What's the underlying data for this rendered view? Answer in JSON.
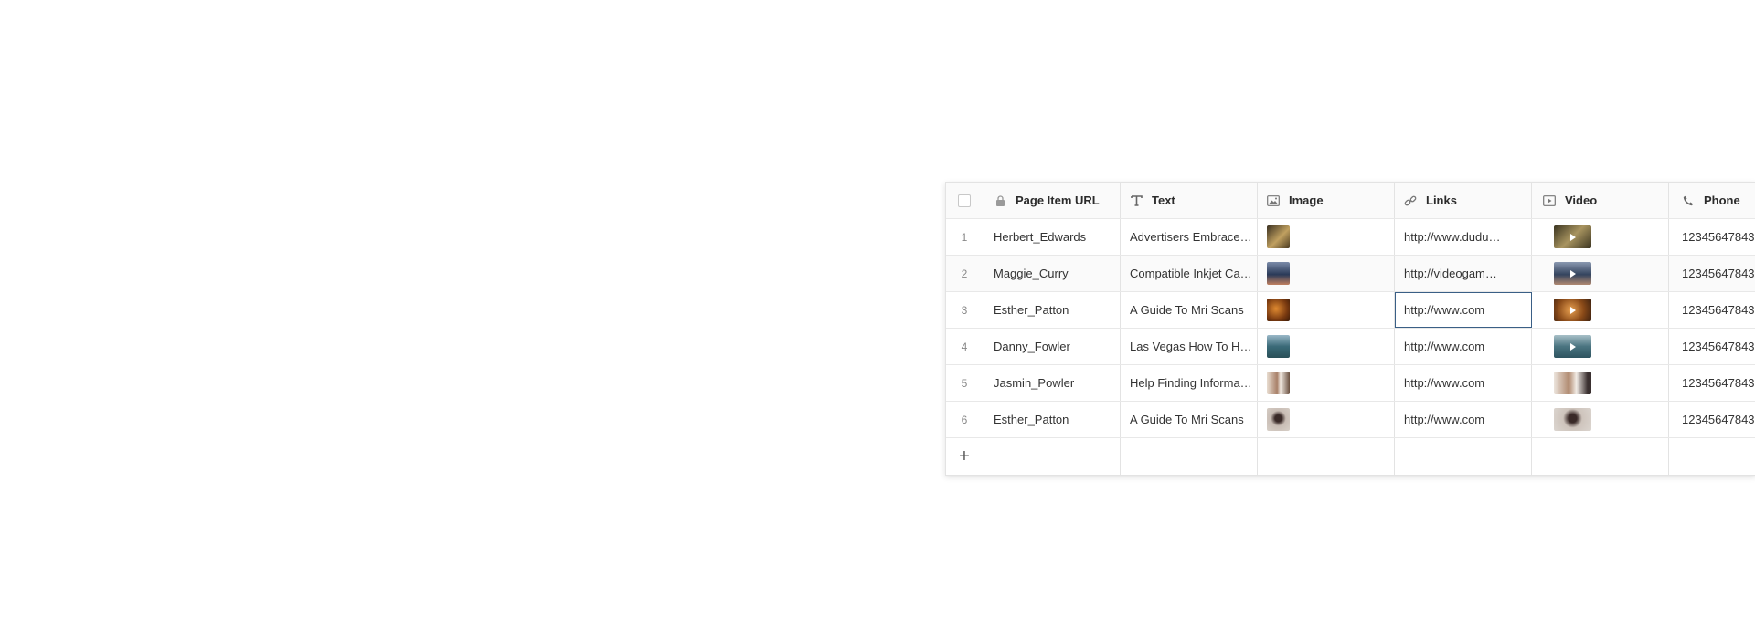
{
  "columns": {
    "url": {
      "label": "Page Item URL",
      "icon": "lock-icon"
    },
    "text": {
      "label": "Text",
      "icon": "text-type-icon"
    },
    "image": {
      "label": "Image",
      "icon": "image-icon"
    },
    "links": {
      "label": "Links",
      "icon": "link-icon"
    },
    "video": {
      "label": "Video",
      "icon": "video-icon"
    },
    "phone": {
      "label": "Phone",
      "icon": "phone-icon"
    }
  },
  "rows": [
    {
      "index": "1",
      "url": "Herbert_Edwards",
      "text": "Advertisers Embrace Rich Media Online",
      "link": "http://www.dudumenus.com",
      "phone": "12345647843",
      "img_color": "#8a6a38",
      "vid_color": "#7a6a40"
    },
    {
      "index": "2",
      "url": "Maggie_Curry",
      "text": "Compatible Inkjet Cartridge",
      "link": "http://videogames.com",
      "phone": "12345647843",
      "img_color": "#3a4e6a",
      "vid_color": "#4a5a78"
    },
    {
      "index": "3",
      "url": "Esther_Patton",
      "text": "A Guide To Mri Scans",
      "link": "http://www.com",
      "phone": "12345647843",
      "img_color": "#a05a25",
      "vid_color": "#b06a30"
    },
    {
      "index": "4",
      "url": "Danny_Fowler",
      "text": "Las Vegas How To Have Fun",
      "link": "http://www.com",
      "phone": "12345647843",
      "img_color": "#4a7a88",
      "vid_color": "#5a8088"
    },
    {
      "index": "5",
      "url": "Jasmin_Powler",
      "text": "Help Finding Information Online",
      "link": "http://www.com",
      "phone": "12345647843",
      "img_color": "#c8b8a8",
      "vid_color": "#d8ccc0"
    },
    {
      "index": "6",
      "url": "Esther_Patton",
      "text": "A Guide To Mri Scans",
      "link": "http://www.com",
      "phone": "12345647843",
      "img_color": "#b8aca4",
      "vid_color": "#c4b8b0"
    }
  ],
  "add_row": {
    "icon": "plus-icon",
    "label": "+"
  }
}
